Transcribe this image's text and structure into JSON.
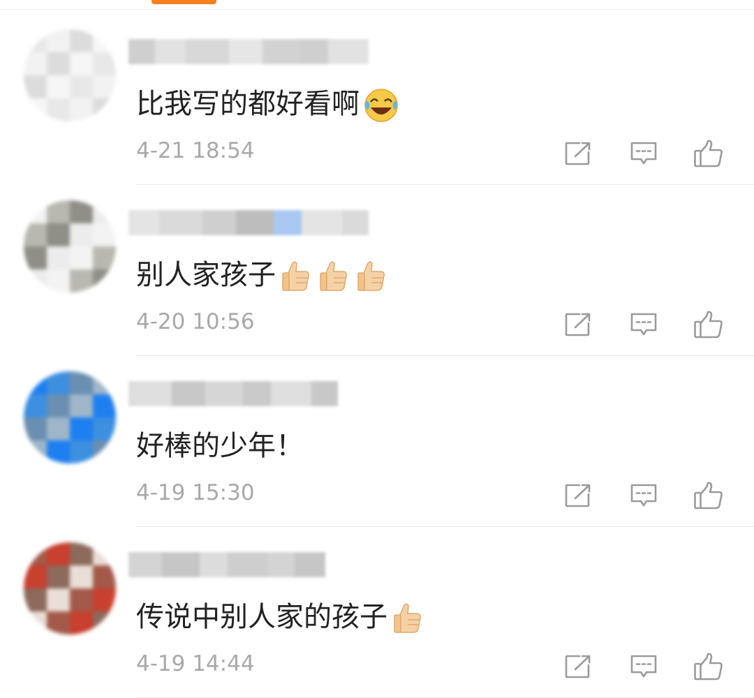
{
  "comments": [
    {
      "text": "比我写的都好看啊",
      "emoji": [
        "laughing-crying"
      ],
      "time": "4-21 18:54",
      "avatar_colors": [
        "#e8e8e8",
        "#f2f2f2",
        "#dcdcdc",
        "#f6f6f6"
      ],
      "username_colors": [
        "#cfcfcf",
        "#e2e2e2",
        "#d8d8d8",
        "#e6e6e6",
        "#d2d2d2"
      ]
    },
    {
      "text": "别人家孩子",
      "emoji": [
        "thumbs-up",
        "thumbs-up",
        "thumbs-up"
      ],
      "time": "4-20 10:56",
      "avatar_colors": [
        "#f3f3f3",
        "#b8b8b0",
        "#8f8f88",
        "#ececec"
      ],
      "username_colors": [
        "#e4e4e4",
        "#dadada",
        "#cfcfcf",
        "#bdbdbd",
        "#a9c8f0"
      ]
    },
    {
      "text": "好棒的少年！",
      "emoji": [],
      "time": "4-19 15:30",
      "avatar_colors": [
        "#1e7ff0",
        "#3d8fe0",
        "#6b8fb0",
        "#9fb6c9"
      ],
      "username_colors": [
        "#dedede",
        "#c8c8c8",
        "#d6d6d6",
        "#cacaca"
      ]
    },
    {
      "text": "传说中别人家的孩子",
      "emoji": [
        "thumbs-up"
      ],
      "time": "4-19 14:44",
      "avatar_colors": [
        "#a35a4a",
        "#c8402f",
        "#8c6a5c",
        "#eadfd8"
      ],
      "username_colors": [
        "#d4d4d4",
        "#c6c6c6",
        "#dcdcdc",
        "#cecece"
      ]
    }
  ],
  "actions": {
    "share_icon": "share-icon",
    "reply_icon": "comment-icon",
    "like_icon": "thumbs-up-icon"
  }
}
